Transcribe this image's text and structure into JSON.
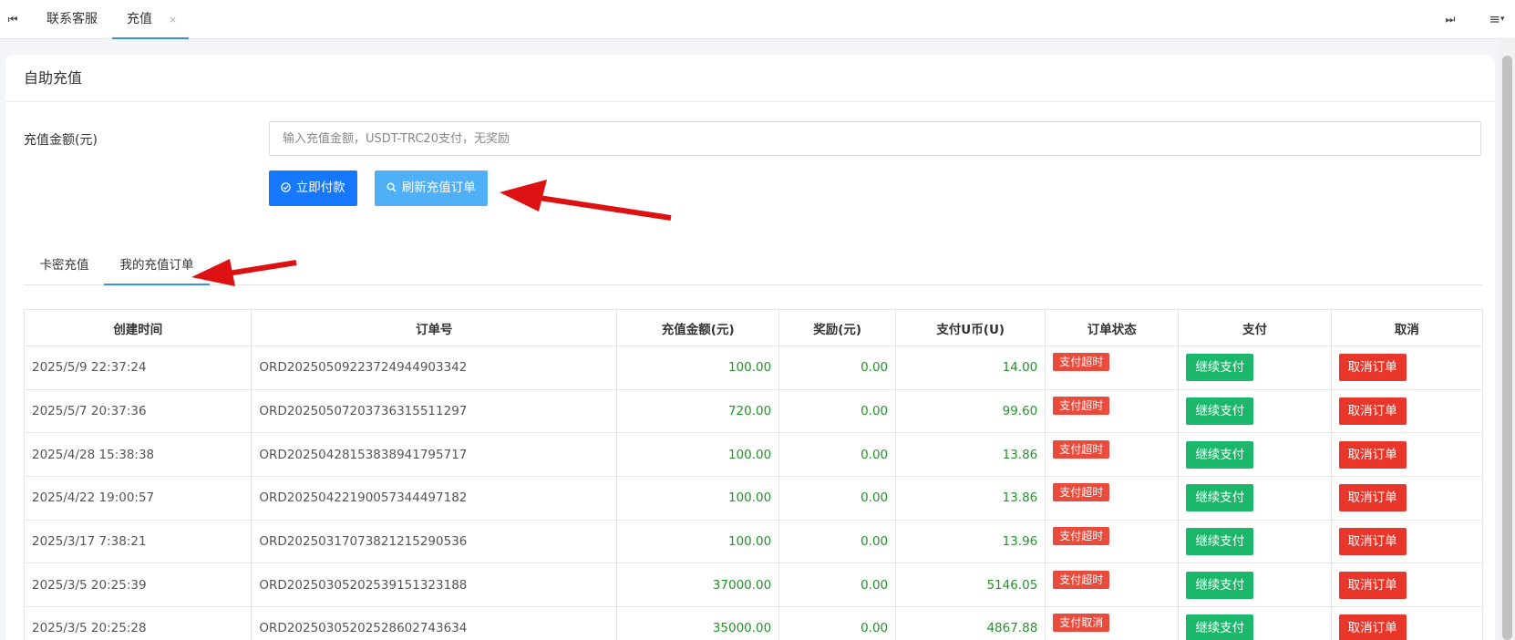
{
  "topbar": {
    "tabs": [
      {
        "label": "联系客服"
      },
      {
        "label": "充值",
        "close": "×"
      }
    ],
    "first_glyph": "⏮",
    "last_glyph": "⏭",
    "menu_glyph": "≡",
    "menu_caret": "▾"
  },
  "card": {
    "title": "自助充值",
    "amount_label": "充值金额(元)",
    "amount_value": "",
    "amount_placeholder": "输入充值金额，USDT-TRC20支付，无奖励",
    "pay_button": "立即付款",
    "refresh_button": "刷新充值订单"
  },
  "icons": {
    "pay": "check-circle-icon",
    "refresh": "search-icon"
  },
  "subtabs": [
    {
      "label": "卡密充值",
      "active": false
    },
    {
      "label": "我的充值订单",
      "active": true
    }
  ],
  "table": {
    "headers": [
      "创建时间",
      "订单号",
      "充值金额(元)",
      "奖励(元)",
      "支付U币(U)",
      "订单状态",
      "支付",
      "取消"
    ],
    "rows": [
      {
        "time": "2025/5/9 22:37:24",
        "order": "ORD2025050922372494490334​2",
        "amount": "100.00",
        "reward": "0.00",
        "usdt": "14.00",
        "status": "支付超时",
        "pay": "继续支付",
        "cancel": "取消订单"
      },
      {
        "time": "2025/5/7 20:37:36",
        "order": "ORD20250507203736315511297",
        "amount": "720.00",
        "reward": "0.00",
        "usdt": "99.60",
        "status": "支付超时",
        "pay": "继续支付",
        "cancel": "取消订单"
      },
      {
        "time": "2025/4/28 15:38:38",
        "order": "ORD20250428153838941795717",
        "amount": "100.00",
        "reward": "0.00",
        "usdt": "13.86",
        "status": "支付超时",
        "pay": "继续支付",
        "cancel": "取消订单"
      },
      {
        "time": "2025/4/22 19:00:57",
        "order": "ORD20250422190057344497182",
        "amount": "100.00",
        "reward": "0.00",
        "usdt": "13.86",
        "status": "支付超时",
        "pay": "继续支付",
        "cancel": "取消订单"
      },
      {
        "time": "2025/3/17 7:38:21",
        "order": "ORD20250317073821215290536",
        "amount": "100.00",
        "reward": "0.00",
        "usdt": "13.96",
        "status": "支付超时",
        "pay": "继续支付",
        "cancel": "取消订单"
      },
      {
        "time": "2025/3/5 20:25:39",
        "order": "ORD20250305202539151323188",
        "amount": "37000.00",
        "reward": "0.00",
        "usdt": "5146.05",
        "status": "支付超时",
        "pay": "继续支付",
        "cancel": "取消订单"
      },
      {
        "time": "2025/3/5 20:25:28",
        "order": "ORD20250305202528602743634",
        "amount": "35000.00",
        "reward": "0.00",
        "usdt": "4867.88",
        "status": "支付取消",
        "pay": "继续支付",
        "cancel": "取消订单"
      }
    ]
  },
  "colors": {
    "primary": "#1677ff",
    "refresh": "#4fb0f7",
    "amount_green": "#23932a",
    "status_red": "#e94b3c",
    "continue_green": "#1bb76b",
    "cancel_red": "#e8362b",
    "annotation_arrow": "#dd1111"
  }
}
